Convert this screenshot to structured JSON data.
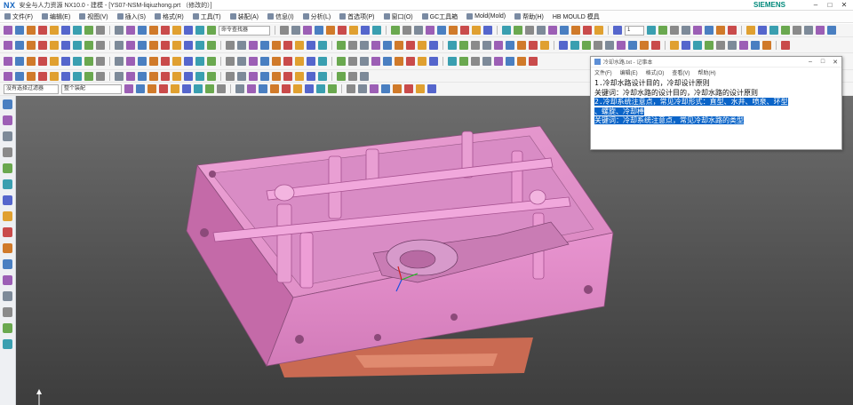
{
  "window": {
    "app_logo": "NX",
    "title": "安全与人力资源  NX10.0 - 建模 - [YS07-NSM-liqiuzhong.prt （修改的）]",
    "brand": "SIEMENS",
    "controls": [
      "–",
      "□",
      "✕"
    ]
  },
  "menu": {
    "items": [
      "文件(F)",
      "编辑(E)",
      "视图(V)",
      "插入(S)",
      "格式(R)",
      "工具(T)",
      "装配(A)",
      "信息(I)",
      "分析(L)",
      "首选项(P)",
      "窗口(O)",
      "GC工具箱",
      "Mold(Mold)",
      "帮助(H)",
      "HB MOULD 模具"
    ]
  },
  "toolbar_fields": {
    "command_finder_placeholder": "命令查找器",
    "layer_value": "1",
    "selection_filter": "没有选择过滤器",
    "selection_scope": "整个装配"
  },
  "notepad": {
    "title": "冷却水路.txt - 记事本",
    "menu": [
      "文件(F)",
      "编辑(E)",
      "格式(O)",
      "查看(V)",
      "帮助(H)"
    ],
    "lines": [
      {
        "text": "1.冷却水路设计目的，冷却设计原则",
        "selected": false
      },
      {
        "text": "关键词：冷却水路的设计目的，冷却水路的设计原则",
        "selected": false
      },
      {
        "text": "2.冷却系统注意点，常见冷却形式：直型、水井、喷泉、环型",
        "selected": true
      },
      {
        "text": "、螺旋、冷却棒",
        "selected": true
      },
      {
        "text": "关键词：冷却系统注意点，常见冷却水路的类型",
        "selected": true
      }
    ]
  },
  "colors": {
    "mold_fill": "#e48ac8",
    "mold_shade": "#c86fae",
    "viewport_bg": "#5a5a5a",
    "selection": "#0a64c8"
  }
}
